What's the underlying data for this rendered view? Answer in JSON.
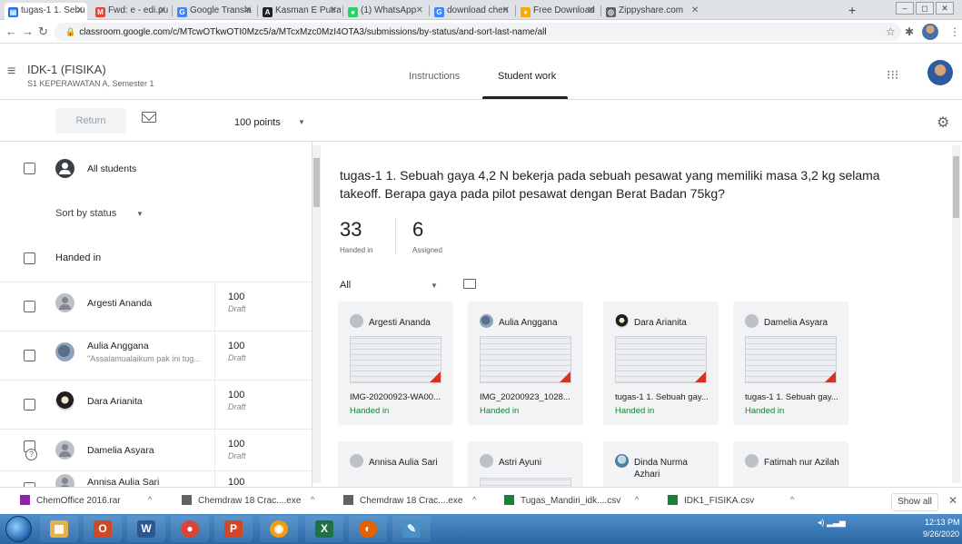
{
  "browser": {
    "tabs": [
      {
        "label": "tugas-1 1. Sebu",
        "color": "#1a73e8",
        "glyph": "▤"
      },
      {
        "label": "Fwd: e - edi.pu",
        "color": "#ea4335",
        "glyph": "M"
      },
      {
        "label": "Google Transla",
        "color": "#4285f4",
        "glyph": "G"
      },
      {
        "label": "Kasman E Putra",
        "color": "#202124",
        "glyph": "A"
      },
      {
        "label": "(1) WhatsApp",
        "color": "#25d366",
        "glyph": "●"
      },
      {
        "label": "download chen",
        "color": "#4285f4",
        "glyph": "G"
      },
      {
        "label": "Free Download",
        "color": "#f9ab00",
        "glyph": "♦"
      },
      {
        "label": "Zippyshare.com",
        "color": "#5f6368",
        "glyph": "◎"
      }
    ],
    "new_tab": "+",
    "window_controls": [
      "–",
      "◻",
      "✕"
    ],
    "url": "classroom.google.com/c/MTcwOTkwOTI0Mzc5/a/MTcxMzc0MzI4OTA3/submissions/by-status/and-sort-last-name/all"
  },
  "header": {
    "class_name": "IDK-1 (FISIKA)",
    "class_section": "S1 KEPERAWATAN A, Semester 1",
    "tabs": [
      {
        "label": "Instructions"
      },
      {
        "label": "Student work"
      }
    ]
  },
  "toolbar": {
    "return_label": "Return",
    "points": "100 points"
  },
  "student_list": {
    "all_students": "All students",
    "sort_label": "Sort by status",
    "group_label": "Handed in",
    "students": [
      {
        "name": "Argesti Ananda",
        "comment": "",
        "grade": "100",
        "status": "Draft"
      },
      {
        "name": "Aulia Anggana",
        "comment": "\"Assalamualaikum pak ini tug...",
        "grade": "100",
        "status": "Draft"
      },
      {
        "name": "Dara Arianita",
        "comment": "",
        "grade": "100",
        "status": "Draft"
      },
      {
        "name": "Damelia Asyara",
        "comment": "",
        "grade": "100",
        "status": "Draft"
      },
      {
        "name": "Annisa Aulia Sari",
        "comment": "",
        "grade": "100",
        "status": ""
      }
    ]
  },
  "main": {
    "assignment_title": "tugas-1 1. Sebuah gaya 4,2 N bekerja pada sebuah pesawat yang memiliki masa 3,2 kg selama takeoff. Berapa gaya pada pilot pesawat dengan Berat Badan 75kg?",
    "handed_in_count": "33",
    "handed_in_label": "Handed in",
    "assigned_count": "6",
    "assigned_label": "Assigned",
    "filter": "All",
    "cards": [
      {
        "name": "Argesti Ananda",
        "file": "IMG-20200923-WA00...",
        "status": "Handed in"
      },
      {
        "name": "Aulia Anggana",
        "file": "IMG_20200923_1028...",
        "status": "Handed in"
      },
      {
        "name": "Dara Arianita",
        "file": "tugas-1 1. Sebuah gay...",
        "status": "Handed in"
      },
      {
        "name": "Damelia Asyara",
        "file": "tugas-1 1. Sebuah gay...",
        "status": "Handed in"
      },
      {
        "name": "Annisa Aulia Sari",
        "file": "",
        "status": ""
      },
      {
        "name": "Astri Ayuni",
        "file": "",
        "status": ""
      },
      {
        "name": "Dinda Nurma Azhari",
        "file": "",
        "status": ""
      },
      {
        "name": "Fatimah nur Azilah",
        "file": "",
        "status": ""
      }
    ]
  },
  "downloads": {
    "items": [
      {
        "label": "ChemOffice 2016.rar",
        "color": "#8e24aa"
      },
      {
        "label": "Chemdraw 18 Crac....exe",
        "color": "#5f6368"
      },
      {
        "label": "Chemdraw 18 Crac....exe",
        "color": "#5f6368"
      },
      {
        "label": "Tugas_Mandiri_idk....csv",
        "color": "#188038"
      },
      {
        "label": "IDK1_FISIKA.csv",
        "color": "#188038"
      }
    ],
    "show_all": "Show all",
    "close": "✕"
  },
  "taskbar": {
    "apps": [
      {
        "name": "explorer",
        "glyph": "▦",
        "color": "#e8b04a"
      },
      {
        "name": "office",
        "glyph": "O",
        "color": "#d24726"
      },
      {
        "name": "word",
        "glyph": "W",
        "color": "#2b5797"
      },
      {
        "name": "chrome",
        "glyph": "●",
        "color": "#db4437"
      },
      {
        "name": "powerpoint",
        "glyph": "P",
        "color": "#d24726"
      },
      {
        "name": "chemdraw",
        "glyph": "◉",
        "color": "#f39c12"
      },
      {
        "name": "excel",
        "glyph": "X",
        "color": "#1e7145"
      },
      {
        "name": "firefox",
        "glyph": "◐",
        "color": "#e66000"
      },
      {
        "name": "paint",
        "glyph": "✎",
        "color": "#4a90c8"
      }
    ],
    "time": "12:13 PM",
    "date": "9/26/2020"
  }
}
